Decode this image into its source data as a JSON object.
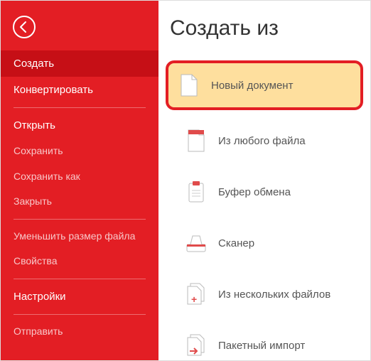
{
  "sidebar": {
    "groups": [
      {
        "items": [
          {
            "label": "Создать",
            "strong": true,
            "active": true
          },
          {
            "label": "Конвертировать",
            "strong": true
          }
        ]
      },
      {
        "items": [
          {
            "label": "Открыть",
            "strong": true
          },
          {
            "label": "Сохранить"
          },
          {
            "label": "Сохранить как"
          },
          {
            "label": "Закрыть"
          }
        ]
      },
      {
        "items": [
          {
            "label": "Уменьшить размер файла"
          },
          {
            "label": "Свойства"
          }
        ]
      },
      {
        "items": [
          {
            "label": "Настройки",
            "strong": true
          }
        ]
      },
      {
        "items": [
          {
            "label": "Отправить"
          }
        ]
      }
    ]
  },
  "main": {
    "title": "Создать из",
    "options": [
      {
        "icon": "blank-doc-icon",
        "label": "Новый документ",
        "highlight": true
      },
      {
        "icon": "any-file-icon",
        "label": "Из любого файла"
      },
      {
        "icon": "clipboard-icon",
        "label": "Буфер обмена"
      },
      {
        "icon": "scanner-icon",
        "label": "Сканер"
      },
      {
        "icon": "multi-file-icon",
        "label": "Из нескольких файлов"
      },
      {
        "icon": "batch-import-icon",
        "label": "Пакетный импорт"
      }
    ]
  },
  "colors": {
    "brand": "#e31e24",
    "highlight_bg": "#fedf9e"
  }
}
